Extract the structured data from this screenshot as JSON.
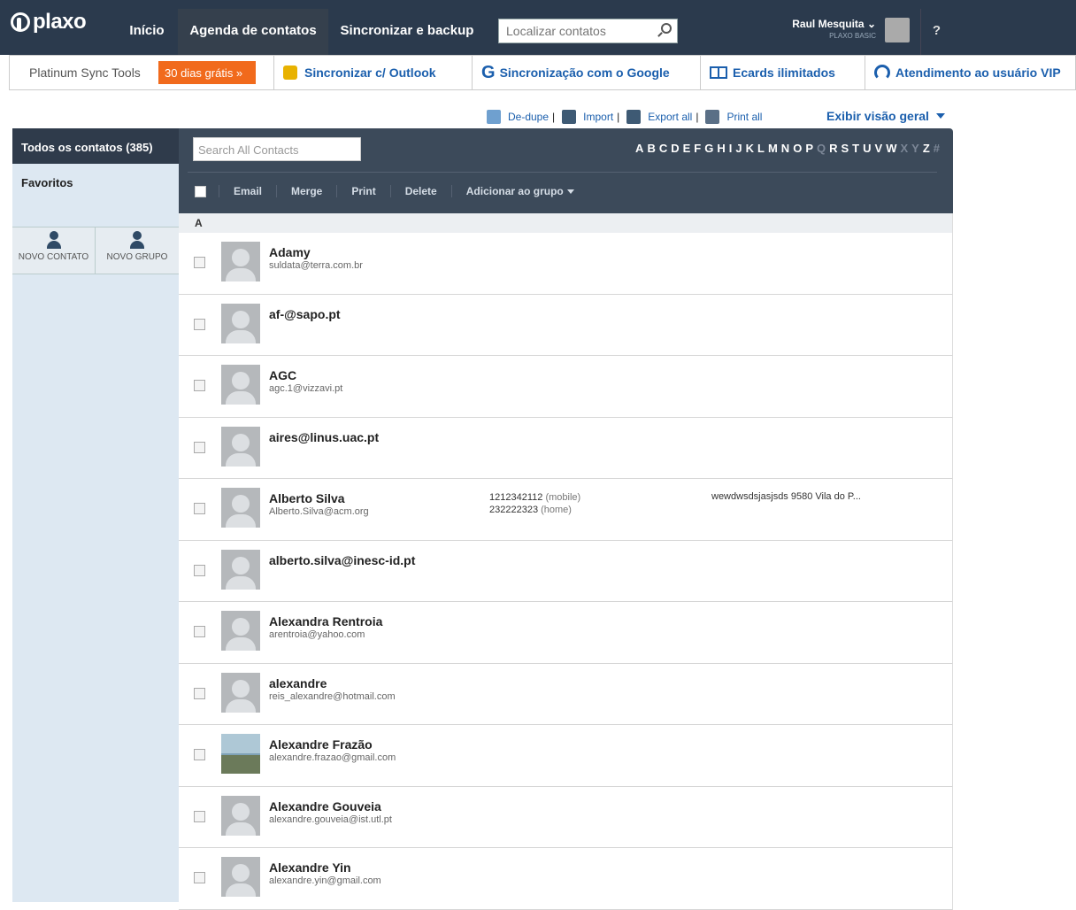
{
  "brand": "plaxo",
  "nav": {
    "inicio": "Início",
    "agenda": "Agenda de contatos",
    "sync": "Sincronizar e backup"
  },
  "search_top": {
    "placeholder": "Localizar contatos"
  },
  "user": {
    "name": "Raul Mesquita",
    "plan": "PLAXO BASIC"
  },
  "help": "?",
  "subnav": {
    "platinum": "Platinum Sync Tools",
    "free": "30 dias grátis »",
    "outlook": "Sincronizar c/ Outlook",
    "google": "Sincronização com o Google",
    "ecards": "Ecards ilimitados",
    "vip": "Atendimento ao usuário VIP"
  },
  "tools": {
    "dedupe": "De-dupe",
    "import": "Import",
    "export": "Export all",
    "print": "Print all",
    "overview": "Exibir visão geral"
  },
  "sidebar": {
    "all": "Todos os contatos (385)",
    "favorites": "Favoritos",
    "new_contact": "NOVO CONTATO",
    "new_group": "NOVO GRUPO"
  },
  "main": {
    "search_placeholder": "Search All Contacts",
    "alphabet": [
      "A",
      "B",
      "C",
      "D",
      "E",
      "F",
      "G",
      "H",
      "I",
      "J",
      "K",
      "L",
      "M",
      "N",
      "O",
      "P",
      "Q",
      "R",
      "S",
      "T",
      "U",
      "V",
      "W",
      "X",
      "Y",
      "Z",
      "#"
    ],
    "alphabet_disabled": [
      "Q",
      "X",
      "Y",
      "#"
    ],
    "actions": {
      "email": "Email",
      "merge": "Merge",
      "print": "Print",
      "delete": "Delete",
      "group": "Adicionar ao grupo"
    },
    "section": "A",
    "contacts": [
      {
        "name": "Adamy",
        "email": "suldata@terra.com.br"
      },
      {
        "name": "af-@sapo.pt",
        "email": ""
      },
      {
        "name": "AGC",
        "email": "agc.1@vizzavi.pt"
      },
      {
        "name": "aires@linus.uac.pt",
        "email": ""
      },
      {
        "name": "Alberto Silva",
        "email": "Alberto.Silva@acm.org",
        "phone1": "1212342112",
        "phone1_type": "(mobile)",
        "phone2": "232222323",
        "phone2_type": "(home)",
        "address": "wewdwsdsjasjsds 9580 Vila do P..."
      },
      {
        "name": "alberto.silva@inesc-id.pt",
        "email": ""
      },
      {
        "name": "Alexandra Rentroia",
        "email": "arentroia@yahoo.com"
      },
      {
        "name": "alexandre",
        "email": "reis_alexandre@hotmail.com"
      },
      {
        "name": "Alexandre Frazão",
        "email": "alexandre.frazao@gmail.com"
      },
      {
        "name": "Alexandre Gouveia",
        "email": "alexandre.gouveia@ist.utl.pt"
      },
      {
        "name": "Alexandre Yin",
        "email": "alexandre.yin@gmail.com"
      }
    ]
  },
  "colors": {
    "topbar": "#2b3a4d",
    "link": "#1b5fad",
    "free_badge": "#f16a1c"
  }
}
